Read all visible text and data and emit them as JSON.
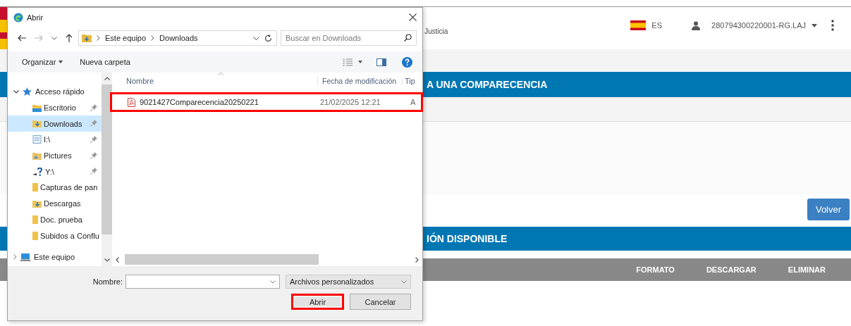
{
  "browser_page": {
    "header": {
      "site_text": "Justicia",
      "language": "ES",
      "user": "280794300220001-RG.LAJ"
    },
    "section_1_title": "A UNA COMPARECENCIA",
    "back_button": "Volver",
    "section_2_title": "IÓN DISPONIBLE",
    "table": {
      "columns": [
        "FORMATO",
        "DESCARGAR",
        "ELIMINAR"
      ]
    }
  },
  "dialog": {
    "title": "Abrir",
    "breadcrumb": [
      "Este equipo",
      "Downloads"
    ],
    "search": {
      "placeholder": "Buscar en Downloads"
    },
    "toolbar": [
      "Organizar",
      "Nueva carpeta"
    ],
    "nav_tree": [
      {
        "label": "Acceso rápido",
        "kind": "star",
        "expanded": true,
        "children": [
          {
            "label": "Escritorio",
            "kind": "desktop",
            "pinned": true,
            "selected": false
          },
          {
            "label": "Downloads",
            "kind": "download",
            "pinned": true,
            "selected": true
          },
          {
            "label": "I:\\",
            "kind": "drive",
            "pinned": true,
            "selected": false
          },
          {
            "label": "Pictures",
            "kind": "pictures",
            "pinned": true,
            "selected": false
          },
          {
            "label": "Y:\\",
            "kind": "network",
            "pinned": true,
            "selected": false
          },
          {
            "label": "Capturas de pan",
            "kind": "folder",
            "pinned": false,
            "selected": false
          },
          {
            "label": "Descargas",
            "kind": "download",
            "pinned": false,
            "selected": false
          },
          {
            "label": "Doc. prueba",
            "kind": "folder",
            "pinned": false,
            "selected": false
          },
          {
            "label": "Subidos a Conflu",
            "kind": "folder",
            "pinned": false,
            "selected": false
          }
        ]
      },
      {
        "label": "Este equipo",
        "kind": "computer",
        "expanded": false
      }
    ],
    "columns": [
      "Nombre",
      "Fecha de modificación",
      "Tip"
    ],
    "files": [
      {
        "name": "9021427Comparecencia20250221",
        "modified": "21/02/2025 12:21",
        "column_3": "A",
        "highlighted": true
      }
    ],
    "filename": {
      "label": "Nombre:"
    },
    "file_type": "Archivos personalizados",
    "buttons": [
      {
        "label": "Abrir",
        "highlighted": true
      },
      {
        "label": "Cancelar",
        "highlighted": false
      }
    ]
  }
}
